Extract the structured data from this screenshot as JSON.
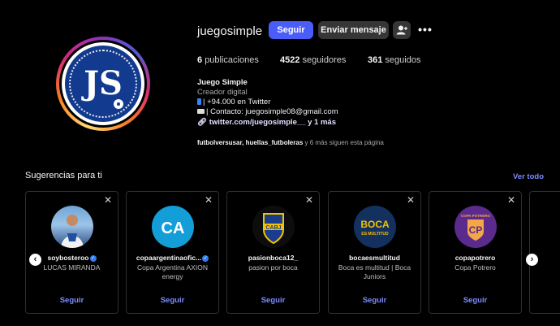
{
  "profile": {
    "username": "juegosimple",
    "follow_label": "Seguir",
    "message_label": "Enviar mensaje",
    "avatar_text": "JS",
    "stats": {
      "posts_count": "6",
      "posts_label": "publicaciones",
      "followers_count": "4522",
      "followers_label": "seguidores",
      "following_count": "361",
      "following_label": "seguidos"
    },
    "bio": {
      "name": "Juego Simple",
      "category": "Creador digital",
      "line1": "| +94.000 en Twitter",
      "line2": "| Contacto: juegosimple08@gmail.com",
      "link": "twitter.com/juegosimple__ y 1 más"
    },
    "followed_by": {
      "names": "futbolversusar, huellas_futboleras",
      "rest": " y 6 más siguen esta página"
    }
  },
  "suggestions": {
    "title": "Sugerencias para ti",
    "see_all": "Ver todo",
    "cards": [
      {
        "username": "soybosteroo",
        "fullname": "LUCAS MIRANDA",
        "follow": "Seguir"
      },
      {
        "username": "copaargentinaofic...",
        "fullname": "Copa Argentina AXION energy",
        "follow": "Seguir"
      },
      {
        "username": "pasionboca12_",
        "fullname": "pasion por boca",
        "follow": "Seguir"
      },
      {
        "username": "bocaesmultitud",
        "fullname": "Boca es multitud | Boca Juniors",
        "follow": "Seguir"
      },
      {
        "username": "copapotrero",
        "fullname": "Copa Potrero",
        "follow": "Seguir"
      }
    ],
    "logos": {
      "ca": "CA",
      "boca_top": "BOCA",
      "boca_bottom": "ES MULTITUD",
      "potrero_top": "COPA POTRERO",
      "potrero_mark": "CP",
      "cabj": "CABJ"
    }
  },
  "colors": {
    "accent": "#4a5df9",
    "link": "#7c8cff",
    "verified": "#2f7bf6"
  }
}
